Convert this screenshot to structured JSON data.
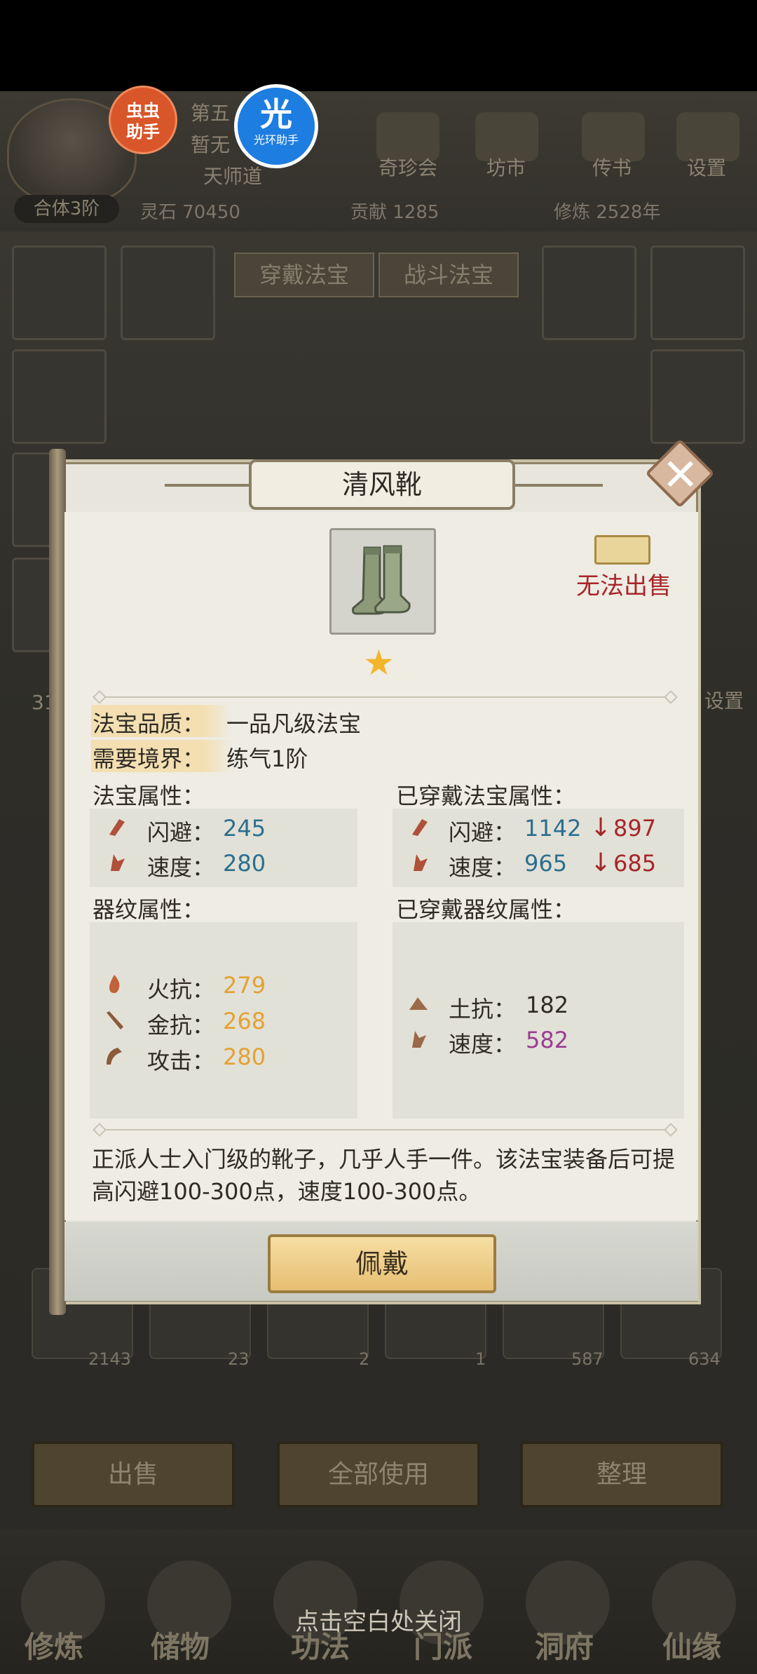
{
  "header": {
    "chapter_partial": "第五",
    "none_partial": "暂无",
    "title": "天师道",
    "realm": "合体3阶",
    "spirit_stone": "灵石 70450",
    "contribution": "贡献 1285",
    "cultivation": "修炼 2528年",
    "menu": [
      "奇珍会",
      "坊市",
      "传书",
      "设置"
    ]
  },
  "overlay_badges": {
    "chongchong": "虫虫\n助手",
    "guang_big": "光",
    "guang_small": "光环助手"
  },
  "equip_tabs": [
    "穿戴法宝",
    "战斗法宝"
  ],
  "bg_text": {
    "left_num": "31",
    "settings": "设置"
  },
  "inventory_counts": [
    "2143",
    "23",
    "2",
    "1",
    "587",
    "634"
  ],
  "bottom_buttons": [
    "出售",
    "全部使用",
    "整理"
  ],
  "nav": [
    "修炼",
    "储物",
    "功法",
    "门派",
    "洞府",
    "仙缘"
  ],
  "close_hint": "点击空白处关闭",
  "dialog": {
    "title": "清风靴",
    "no_sell": "无法出售",
    "quality_label": "法宝品质：",
    "quality_value": "一品凡级法宝",
    "realm_label": "需要境界：",
    "realm_value": "练气1阶",
    "attr_title": "法宝属性：",
    "worn_attr_title": "已穿戴法宝属性：",
    "attrs": [
      {
        "name": "闪避：",
        "value": "245"
      },
      {
        "name": "速度：",
        "value": "280"
      }
    ],
    "worn_attrs": [
      {
        "name": "闪避：",
        "value": "1142",
        "arrow": "↓",
        "after": "897"
      },
      {
        "name": "速度：",
        "value": "965",
        "arrow": "↓",
        "after": "685"
      }
    ],
    "pattern_title": "器纹属性：",
    "worn_pattern_title": "已穿戴器纹属性：",
    "patterns": [
      {
        "name": "火抗：",
        "value": "279"
      },
      {
        "name": "金抗：",
        "value": "268"
      },
      {
        "name": "攻击：",
        "value": "280"
      }
    ],
    "worn_patterns": [
      {
        "name": "土抗：",
        "value": "182"
      },
      {
        "name": "速度：",
        "value": "582"
      }
    ],
    "description": "正派人士入门级的靴子，几乎人手一件。该法宝装备后可提高闪避100-300点，速度100-300点。",
    "wear_button": "佩戴",
    "stars": "★",
    "colors": {
      "blue": "#2a6f8f",
      "red": "#a5262a",
      "orange": "#e3a233",
      "purple": "#9c3c93"
    }
  }
}
